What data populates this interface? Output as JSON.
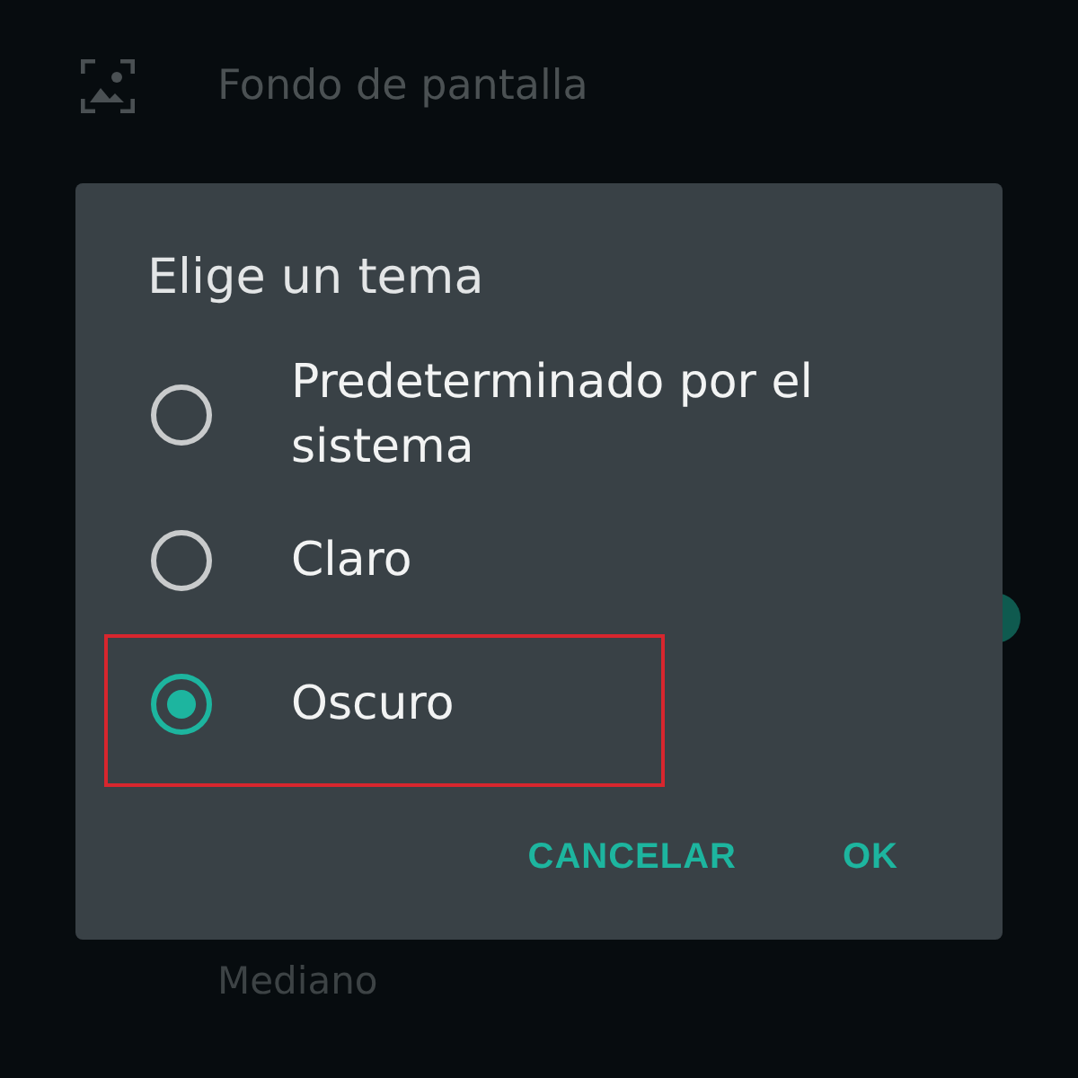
{
  "background": {
    "wallpaper_label": "Fondo de pantalla",
    "switch": {
      "on": true
    },
    "font_size_value": "Mediano"
  },
  "dialog": {
    "title": "Elige un tema",
    "options": [
      {
        "label": "Predeterminado por el sistema",
        "selected": false,
        "highlighted": false
      },
      {
        "label": "Claro",
        "selected": false,
        "highlighted": false
      },
      {
        "label": "Oscuro",
        "selected": true,
        "highlighted": true
      }
    ],
    "buttons": [
      "CANCELAR",
      "OK"
    ]
  }
}
